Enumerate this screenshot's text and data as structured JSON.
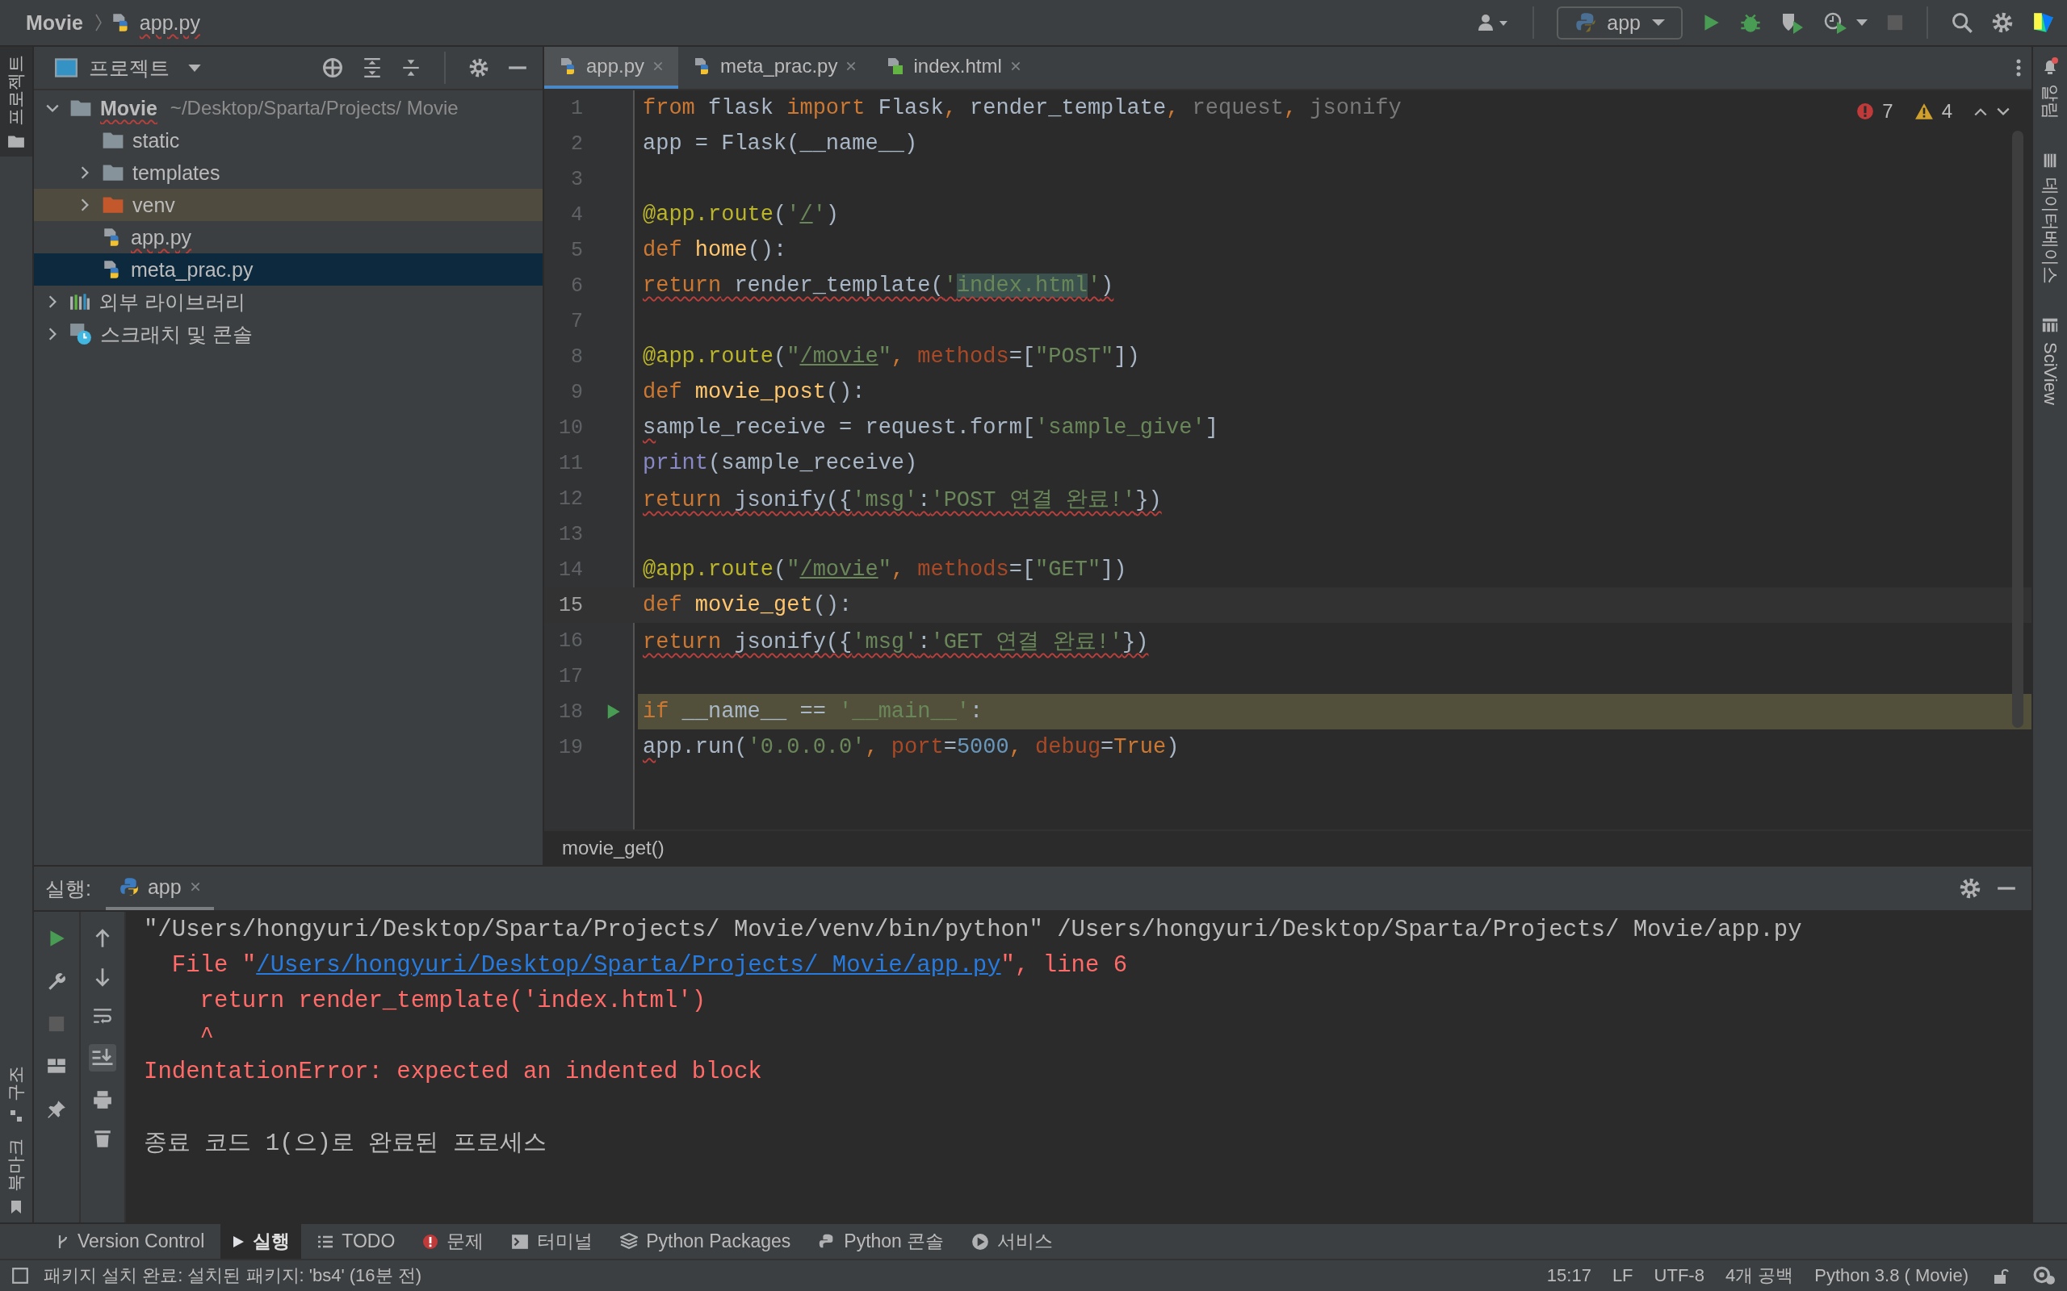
{
  "breadcrumb": [
    {
      "label": "Movie",
      "kind": "project",
      "error": false
    },
    {
      "label": "app.py",
      "kind": "python",
      "error": true
    }
  ],
  "run_config": {
    "label": "app"
  },
  "left_stripe": [
    {
      "label": "프로젝트",
      "selected": true,
      "kind": "folder"
    }
  ],
  "left_stripe_bottom": [
    {
      "label": "구조",
      "kind": "structure"
    },
    {
      "label": "북마크",
      "kind": "bookmark"
    }
  ],
  "right_stripe": [
    {
      "label": "알림",
      "kind": "bell"
    },
    {
      "label": "데이터베이스",
      "kind": "database"
    },
    {
      "label": "SciView",
      "kind": "grid"
    }
  ],
  "project_panel": {
    "title": "프로젝트",
    "tree": [
      {
        "label": "Movie",
        "hint": "~/Desktop/Sparta/Projects/ Movie",
        "kind": "project",
        "expanded": true,
        "selected": false,
        "error": true,
        "children": [
          {
            "label": "static",
            "kind": "folder",
            "selected": false,
            "error": false
          },
          {
            "label": "templates",
            "kind": "folder",
            "expanded": false,
            "selected": false,
            "error": false
          },
          {
            "label": "venv",
            "kind": "excluded",
            "expanded": false,
            "selected": false,
            "error": false
          },
          {
            "label": "app.py",
            "kind": "python",
            "selected": false,
            "error": true
          },
          {
            "label": "meta_prac.py",
            "kind": "python",
            "selected": true,
            "error": false
          }
        ]
      },
      {
        "label": "외부 라이브러리",
        "kind": "library",
        "expanded": false,
        "selected": false,
        "error": false
      },
      {
        "label": "스크래치 및 콘솔",
        "kind": "scratch",
        "expanded": false,
        "selected": false,
        "error": false
      }
    ]
  },
  "editor_tabs": [
    {
      "label": "app.py",
      "kind": "python",
      "selected": true
    },
    {
      "label": "meta_prac.py",
      "kind": "python",
      "selected": false
    },
    {
      "label": "index.html",
      "kind": "html",
      "selected": false
    }
  ],
  "inspections": {
    "errors": "7",
    "warnings": "4"
  },
  "code": [
    {
      "number": "1",
      "current": false,
      "highlighted": false,
      "run_marker": false,
      "tokens": [
        {
          "text": "from",
          "kind": "keyword"
        },
        {
          "text": " flask ",
          "kind": "plain"
        },
        {
          "text": "import",
          "kind": "keyword"
        },
        {
          "text": " Flask",
          "kind": "plain"
        },
        {
          "text": ", ",
          "kind": "keyword"
        },
        {
          "text": "render_template",
          "kind": "plain"
        },
        {
          "text": ", ",
          "kind": "keyword"
        },
        {
          "text": "request",
          "kind": "dim"
        },
        {
          "text": ", ",
          "kind": "keyword"
        },
        {
          "text": "jsonify",
          "kind": "dim"
        }
      ]
    },
    {
      "number": "2",
      "current": false,
      "highlighted": false,
      "run_marker": false,
      "tokens": [
        {
          "text": "app = Flask(__name__)",
          "kind": "plain"
        }
      ]
    },
    {
      "number": "3",
      "current": false,
      "highlighted": false,
      "run_marker": false
    },
    {
      "number": "4",
      "current": false,
      "highlighted": false,
      "run_marker": false,
      "tokens": [
        {
          "text": "@app.route",
          "kind": "decorator"
        },
        {
          "text": "(",
          "kind": "plain"
        },
        {
          "text": "'",
          "kind": "string"
        },
        {
          "text": "/",
          "kind": "path"
        },
        {
          "text": "'",
          "kind": "string"
        },
        {
          "text": ")",
          "kind": "plain"
        }
      ]
    },
    {
      "number": "5",
      "current": false,
      "highlighted": false,
      "run_marker": false,
      "tokens": [
        {
          "text": "def ",
          "kind": "keyword"
        },
        {
          "text": "home",
          "kind": "function"
        },
        {
          "text": "():",
          "kind": "plain"
        }
      ]
    },
    {
      "number": "6",
      "current": false,
      "highlighted": false,
      "run_marker": false,
      "tokens": [
        {
          "text": "return",
          "kind": "keyword",
          "squiggle": true
        },
        {
          "text": " render_template(",
          "kind": "plain",
          "squiggle": true
        },
        {
          "text": "'",
          "kind": "string",
          "squiggle": true
        },
        {
          "text": "index.html",
          "kind": "string",
          "squiggle": true,
          "marked": true
        },
        {
          "text": "'",
          "kind": "string",
          "squiggle": true
        },
        {
          "text": ")",
          "kind": "plain",
          "squiggle": true
        }
      ]
    },
    {
      "number": "7",
      "current": false,
      "highlighted": false,
      "run_marker": false
    },
    {
      "number": "8",
      "current": false,
      "highlighted": false,
      "run_marker": false,
      "tokens": [
        {
          "text": "@app.route",
          "kind": "decorator"
        },
        {
          "text": "(",
          "kind": "plain"
        },
        {
          "text": "\"",
          "kind": "string"
        },
        {
          "text": "/movie",
          "kind": "path"
        },
        {
          "text": "\"",
          "kind": "string"
        },
        {
          "text": ", ",
          "kind": "keyword"
        },
        {
          "text": "methods",
          "kind": "param"
        },
        {
          "text": "=[",
          "kind": "plain"
        },
        {
          "text": "\"POST\"",
          "kind": "string"
        },
        {
          "text": "])",
          "kind": "plain"
        }
      ]
    },
    {
      "number": "9",
      "current": false,
      "highlighted": false,
      "run_marker": false,
      "tokens": [
        {
          "text": "def ",
          "kind": "keyword"
        },
        {
          "text": "movie_post",
          "kind": "function"
        },
        {
          "text": "():",
          "kind": "plain"
        }
      ]
    },
    {
      "number": "10",
      "current": false,
      "highlighted": false,
      "run_marker": false,
      "tokens": [
        {
          "text": "s",
          "kind": "plain",
          "squiggle": true
        },
        {
          "text": "ample_receive = request.form[",
          "kind": "plain"
        },
        {
          "text": "'sample_give'",
          "kind": "string"
        },
        {
          "text": "]",
          "kind": "plain"
        }
      ]
    },
    {
      "number": "11",
      "current": false,
      "highlighted": false,
      "run_marker": false,
      "tokens": [
        {
          "text": "print",
          "kind": "builtin"
        },
        {
          "text": "(sample_receive)",
          "kind": "plain"
        }
      ]
    },
    {
      "number": "12",
      "current": false,
      "highlighted": false,
      "run_marker": false,
      "tokens": [
        {
          "text": "return",
          "kind": "keyword",
          "squiggle": true
        },
        {
          "text": " jsonify({",
          "kind": "plain",
          "squiggle": true
        },
        {
          "text": "'msg'",
          "kind": "string",
          "squiggle": true
        },
        {
          "text": ":",
          "kind": "plain",
          "squiggle": true
        },
        {
          "text": "'POST 연결 완료!'",
          "kind": "string",
          "squiggle": true
        },
        {
          "text": "})",
          "kind": "plain",
          "squiggle": true
        }
      ]
    },
    {
      "number": "13",
      "current": false,
      "highlighted": false,
      "run_marker": false
    },
    {
      "number": "14",
      "current": false,
      "highlighted": false,
      "run_marker": false,
      "tokens": [
        {
          "text": "@app.route",
          "kind": "decorator"
        },
        {
          "text": "(",
          "kind": "plain"
        },
        {
          "text": "\"",
          "kind": "string"
        },
        {
          "text": "/movie",
          "kind": "path"
        },
        {
          "text": "\"",
          "kind": "string"
        },
        {
          "text": ", ",
          "kind": "keyword"
        },
        {
          "text": "methods",
          "kind": "param"
        },
        {
          "text": "=[",
          "kind": "plain"
        },
        {
          "text": "\"GET\"",
          "kind": "string"
        },
        {
          "text": "])",
          "kind": "plain"
        }
      ]
    },
    {
      "number": "15",
      "current": true,
      "highlighted": false,
      "run_marker": false,
      "tokens": [
        {
          "text": "def ",
          "kind": "keyword"
        },
        {
          "text": "movie_get",
          "kind": "function"
        },
        {
          "text": "():",
          "kind": "plain"
        }
      ]
    },
    {
      "number": "16",
      "current": false,
      "highlighted": false,
      "run_marker": false,
      "tokens": [
        {
          "text": "return",
          "kind": "keyword",
          "squiggle": true
        },
        {
          "text": " jsonify({",
          "kind": "plain",
          "squiggle": true
        },
        {
          "text": "'msg'",
          "kind": "string",
          "squiggle": true
        },
        {
          "text": ":",
          "kind": "plain",
          "squiggle": true
        },
        {
          "text": "'GET 연결 완료!'",
          "kind": "string",
          "squiggle": true
        },
        {
          "text": "})",
          "kind": "plain",
          "squiggle": true
        }
      ]
    },
    {
      "number": "17",
      "current": false,
      "highlighted": false,
      "run_marker": false
    },
    {
      "number": "18",
      "current": false,
      "highlighted": true,
      "run_marker": true,
      "tokens": [
        {
          "text": "if",
          "kind": "keyword"
        },
        {
          "text": " __name__ == ",
          "kind": "plain"
        },
        {
          "text": "'__main__'",
          "kind": "string"
        },
        {
          "text": ":",
          "kind": "plain"
        }
      ]
    },
    {
      "number": "19",
      "current": false,
      "highlighted": false,
      "run_marker": false,
      "tokens": [
        {
          "text": "a",
          "kind": "plain",
          "squiggle": true
        },
        {
          "text": "pp.run(",
          "kind": "plain"
        },
        {
          "text": "'0.0.0.0'",
          "kind": "string"
        },
        {
          "text": ", ",
          "kind": "keyword"
        },
        {
          "text": "port",
          "kind": "param"
        },
        {
          "text": "=",
          "kind": "plain"
        },
        {
          "text": "5000",
          "kind": "number"
        },
        {
          "text": ", ",
          "kind": "keyword"
        },
        {
          "text": "debug",
          "kind": "param"
        },
        {
          "text": "=",
          "kind": "plain"
        },
        {
          "text": "True",
          "kind": "keyword"
        },
        {
          "text": ")",
          "kind": "plain"
        }
      ]
    }
  ],
  "editor_breadcrumb": "movie_get()",
  "run_panel": {
    "label": "실행:",
    "tabs": [
      {
        "label": "app",
        "selected": true
      }
    ],
    "console": [
      {
        "segments": [
          {
            "text": "\"/Users/hongyuri/Desktop/Sparta/Projects/ Movie/venv/bin/python\" /Users/hongyuri/Desktop/Sparta/Projects/ Movie/app.py",
            "kind": "plain"
          }
        ]
      },
      {
        "segments": [
          {
            "text": "  File \"",
            "kind": "error"
          },
          {
            "text": "/Users/hongyuri/Desktop/Sparta/Projects/ Movie/app.py",
            "kind": "link"
          },
          {
            "text": "\", line 6",
            "kind": "error"
          }
        ]
      },
      {
        "segments": [
          {
            "text": "    return render_template('index.html')",
            "kind": "error"
          }
        ]
      },
      {
        "segments": [
          {
            "text": "    ^",
            "kind": "error"
          }
        ]
      },
      {
        "segments": [
          {
            "text": "IndentationError: expected an indented block",
            "kind": "error"
          }
        ]
      },
      {
        "segments": [
          {
            "text": "종료 코드 1(으)로 완료된 프로세스",
            "kind": "plain"
          }
        ]
      }
    ]
  },
  "tool_tabs": [
    {
      "label": "Version Control",
      "kind": "vcs",
      "selected": false
    },
    {
      "label": "실행",
      "kind": "run",
      "selected": true
    },
    {
      "label": "TODO",
      "kind": "todo",
      "selected": false
    },
    {
      "label": "문제",
      "kind": "problems",
      "selected": false
    },
    {
      "label": "터미널",
      "kind": "terminal",
      "selected": false
    },
    {
      "label": "Python Packages",
      "kind": "packages",
      "selected": false
    },
    {
      "label": "Python 콘솔",
      "kind": "python",
      "selected": false
    },
    {
      "label": "서비스",
      "kind": "services",
      "selected": false
    }
  ],
  "status_bar": {
    "message": "패키지 설치 완료: 설치된 패키지: 'bs4' (16분 전)",
    "items": [
      "15:17",
      "LF",
      "UTF-8",
      "4개 공백",
      "Python 3.8 ( Movie)"
    ]
  }
}
